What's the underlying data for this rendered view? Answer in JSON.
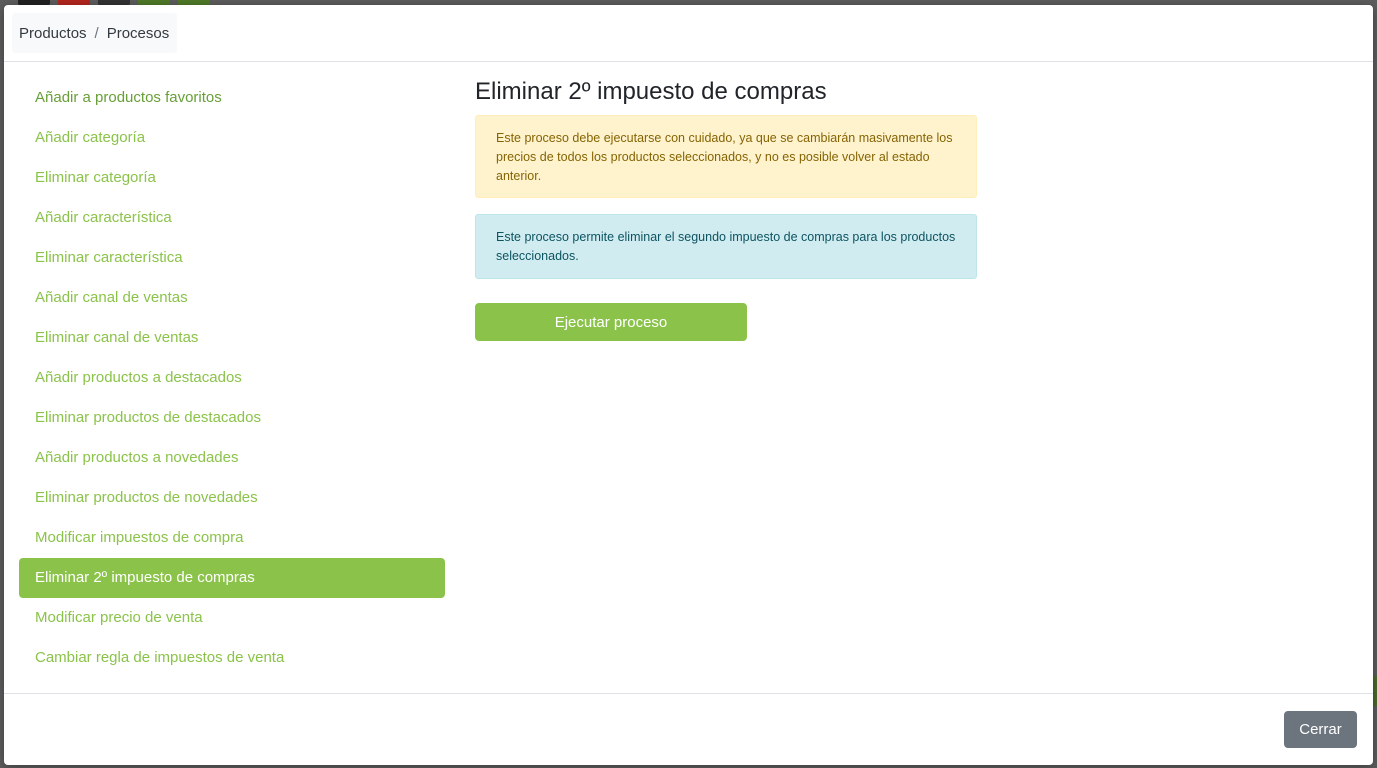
{
  "breadcrumb": {
    "items": [
      "Productos",
      "Procesos"
    ],
    "separator": "/"
  },
  "sidebar": {
    "items": [
      {
        "label": "Añadir a productos favoritos"
      },
      {
        "label": "Añadir categoría"
      },
      {
        "label": "Eliminar categoría"
      },
      {
        "label": "Añadir característica"
      },
      {
        "label": "Eliminar característica"
      },
      {
        "label": "Añadir canal de ventas"
      },
      {
        "label": "Eliminar canal de ventas"
      },
      {
        "label": "Añadir productos a destacados"
      },
      {
        "label": "Eliminar productos de destacados"
      },
      {
        "label": "Añadir productos a novedades"
      },
      {
        "label": "Eliminar productos de novedades"
      },
      {
        "label": "Modificar impuestos de compra"
      },
      {
        "label": "Eliminar 2º impuesto de compras",
        "active": true
      },
      {
        "label": "Modificar precio de venta"
      },
      {
        "label": "Cambiar regla de impuestos de venta"
      }
    ]
  },
  "main": {
    "title": "Eliminar 2º impuesto de compras",
    "warning_text": "Este proceso debe ejecutarse con cuidado, ya que se cambiarán masivamente los precios de todos los productos seleccionados, y no es posible volver al estado anterior.",
    "info_text": "Este proceso permite eliminar el segundo impuesto de compras para los productos seleccionados.",
    "run_button_label": "Ejecutar proceso"
  },
  "footer": {
    "close_label": "Cerrar"
  },
  "colors": {
    "accent": "#8bc34a",
    "warning_bg": "#fff3cd",
    "info_bg": "#d1ecf1",
    "secondary": "#6c757d"
  }
}
